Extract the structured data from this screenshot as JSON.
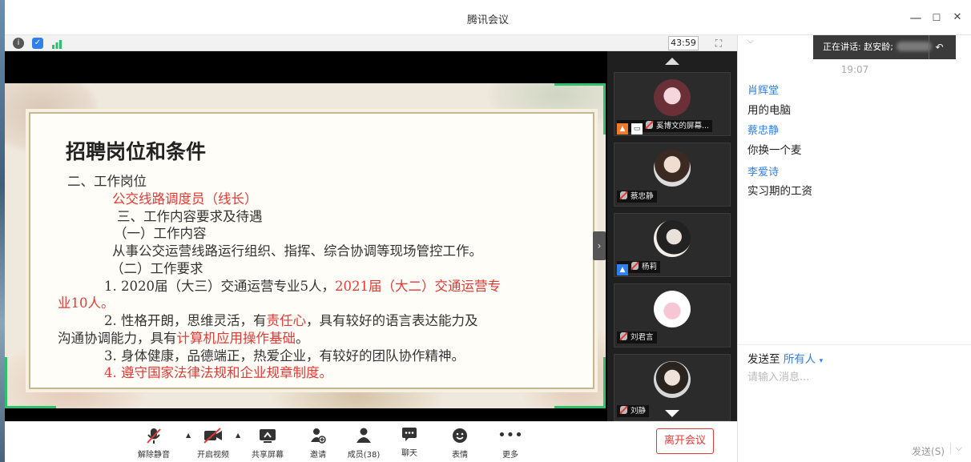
{
  "window": {
    "title": "腾讯会议",
    "minimize": "—",
    "maximize": "☐",
    "close": "✕"
  },
  "meeting_bar": {
    "timer": "43:59",
    "fullscreen_icon": "fullscreen-icon"
  },
  "slide": {
    "title": "招聘岗位和条件",
    "lines": [
      "二、工作岗位",
      "公交线路调度员（线长）",
      "三、工作内容要求及待遇",
      "（一）工作内容",
      "从事公交运营线路运行组织、指挥、综合协调等现场管控工作。",
      "（二）工作要求",
      "1. 2020届（大三）交通运营专业5人，",
      "2021届（大二）交通运营专",
      "业10人。",
      "2. 性格开朗，思维灵活，有",
      "责任心",
      "，具有较好的语言表达能力及",
      "沟通协调能力，具有",
      "计算机应用操作基础",
      "。",
      "3. 身体健康，品德端正，热爱企业，有较好的团队协作精神。",
      "4. 遵守国家法律法规和企业规章制度。"
    ]
  },
  "participants": [
    {
      "name": "奚博文的屏幕...",
      "sharing": true
    },
    {
      "name": "蔡忠静"
    },
    {
      "name": "杨莉",
      "host_badge": true
    },
    {
      "name": "刘君言"
    },
    {
      "name": "刘静"
    }
  ],
  "toolbar": {
    "unmute": "解除静音",
    "start_video": "开启视频",
    "share_screen": "共享屏幕",
    "invite": "邀请",
    "members": "成员(38)",
    "chat": "聊天",
    "reactions": "表情",
    "more": "更多",
    "leave": "离开会议"
  },
  "chat": {
    "speaking_prefix": "正在讲话: 赵安龄;",
    "time": "19:07",
    "messages": [
      {
        "sender": "肖辉堂",
        "text": "用的电脑"
      },
      {
        "sender": "蔡忠静",
        "text": "你换一个麦"
      },
      {
        "sender": "李爱诗",
        "text": "实习期的工资"
      }
    ],
    "send_to_label": "发送至",
    "send_to_target": "所有人",
    "input_placeholder": "请输入消息...",
    "send_button": "发送(S)"
  },
  "colors": {
    "accent": "#2f80ed",
    "danger": "#e53935",
    "slide_frame": "#c9b791",
    "corner_green": "#2ec06a"
  }
}
